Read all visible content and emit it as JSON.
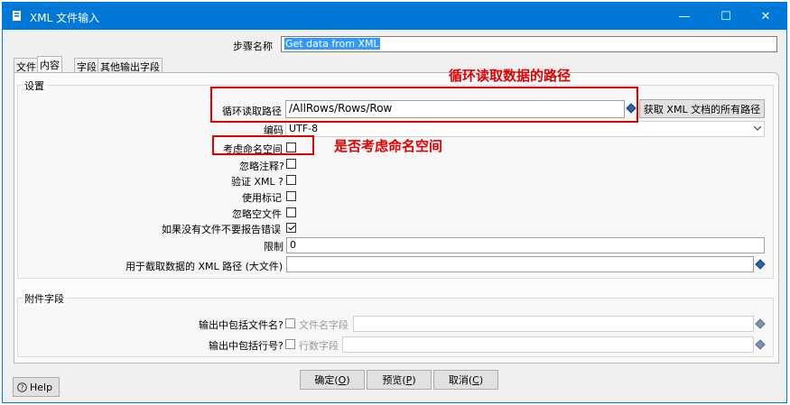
{
  "window": {
    "title": "XML 文件输入",
    "minimize": "—",
    "maximize": "☐",
    "close": "✕"
  },
  "step_name": {
    "label": "步骤名称",
    "value": "Get data from XML"
  },
  "tabs": [
    {
      "label": "文件"
    },
    {
      "label": "内容"
    },
    {
      "label": "字段"
    },
    {
      "label": "其他输出字段"
    }
  ],
  "settings": {
    "group_title": "设置",
    "loop_path_label": "循环读取路径",
    "loop_path_value": "/AllRows/Rows/Row",
    "get_paths_button": "获取 XML 文档的所有路径",
    "encoding_label": "编码",
    "encoding_value": "UTF-8",
    "namespace_label": "考虑命名空间",
    "ignore_comments_label": "忽略注释?",
    "validate_xml_label": "验证 XML ?",
    "use_token_label": "使用标记",
    "ignore_empty_label": "忽略空文件",
    "no_error_label": "如果没有文件不要报告错误",
    "limit_label": "限制",
    "limit_value": "0",
    "prune_path_label": "用于截取数据的 XML 路径 (大文件)",
    "prune_path_value": ""
  },
  "additional": {
    "group_title": "附件字段",
    "include_filename_label": "输出中包括文件名?",
    "filename_field_placeholder": "文件名字段",
    "include_rownum_label": "输出中包括行号?",
    "rownum_field_placeholder": "行数字段"
  },
  "buttons": {
    "help": "Help",
    "ok_main": "确定(",
    "ok_key": "O",
    "ok_end": ")",
    "preview_main": "预览(",
    "preview_key": "P",
    "preview_end": ")",
    "cancel_main": "取消(",
    "cancel_key": "C",
    "cancel_end": ")"
  },
  "annotations": {
    "loop_path_note": "循环读取数据的路径",
    "namespace_note": "是否考虑命名空间"
  },
  "state": {
    "namespace_checked": false,
    "ignore_comments_checked": false,
    "validate_xml_checked": false,
    "use_token_checked": false,
    "ignore_empty_checked": false,
    "no_error_checked": true,
    "include_filename_checked": false,
    "include_rownum_checked": false,
    "active_tab": "内容"
  },
  "colors": {
    "titlebar": "#0078d7",
    "annotation": "#e00000",
    "selection": "#3399ff"
  }
}
